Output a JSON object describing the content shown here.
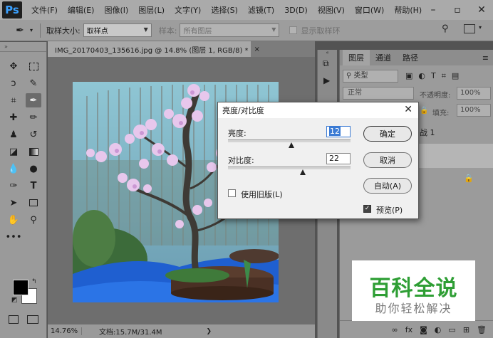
{
  "app": {
    "logo_text": "Ps",
    "menus": [
      "文件(F)",
      "编辑(E)",
      "图像(I)",
      "图层(L)",
      "文字(Y)",
      "选择(S)",
      "滤镜(T)",
      "3D(D)",
      "视图(V)",
      "窗口(W)",
      "帮助(H)"
    ]
  },
  "options_bar": {
    "sample_size_label": "取样大小:",
    "sample_size_value": "取样点",
    "sample_label": "样本:",
    "sample_value": "所有图层",
    "show_ring_label": "显示取样环"
  },
  "document": {
    "tab_title": "IMG_20170403_135616.jpg @ 14.8% (图层 1, RGB/8) *",
    "tab_close": "×"
  },
  "status_bar": {
    "zoom": "14.76%",
    "doc_info": "文档:15.7M/31.4M"
  },
  "layers_panel": {
    "tabs": [
      "图层",
      "通道",
      "路径"
    ],
    "filter_type": "类型",
    "blend_mode": "正常",
    "opacity_label": "不透明度:",
    "opacity_value": "100%",
    "lock_label": "锁定:",
    "fill_label": "填充:",
    "fill_value": "100%",
    "layer_name_partial": "战 1"
  },
  "dialog": {
    "title": "亮度/对比度",
    "brightness_label": "亮度:",
    "brightness_value": "12",
    "contrast_label": "对比度:",
    "contrast_value": "22",
    "legacy_label": "使用旧版(L)",
    "legacy_checked": false,
    "ok_label": "确定",
    "cancel_label": "取消",
    "auto_label": "自动(A)",
    "preview_label": "预览(P)",
    "preview_checked": true,
    "brightness_level": 0.52,
    "contrast_level": 0.61
  },
  "watermark": {
    "title": "百科全说",
    "subtitle": "助你轻松解决"
  }
}
